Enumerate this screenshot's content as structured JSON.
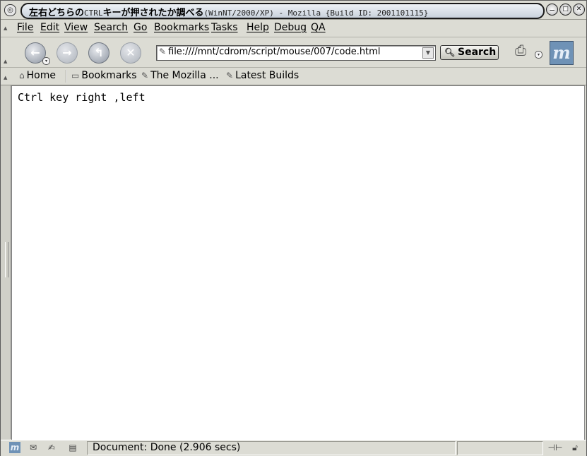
{
  "window": {
    "title_bold": "左右どちらの",
    "title_ctrl": "CTRL",
    "title_bold2": "キーが押されたか調べる",
    "title_rest": "(WinNT/2000/XP) - Mozilla {Build ID: 2001101115}"
  },
  "menubar": {
    "items": [
      "File",
      "Edit",
      "View",
      "Search",
      "Go",
      "Bookmarks",
      "Tasks",
      "Help",
      "Debug",
      "QA"
    ]
  },
  "navbar": {
    "url": "file:////mnt/cdrom/script/mouse/007/code.html",
    "search_label": "Search"
  },
  "personal_toolbar": {
    "home": "Home",
    "bookmarks": "Bookmarks",
    "mozilla": "The Mozilla ...",
    "latest": "Latest Builds"
  },
  "content": {
    "text": "Ctrl key right ,left"
  },
  "statusbar": {
    "text": "Document: Done (2.906 secs)"
  },
  "colors": {
    "chrome": "#dcdcd4",
    "logo": "#6f92b6"
  }
}
